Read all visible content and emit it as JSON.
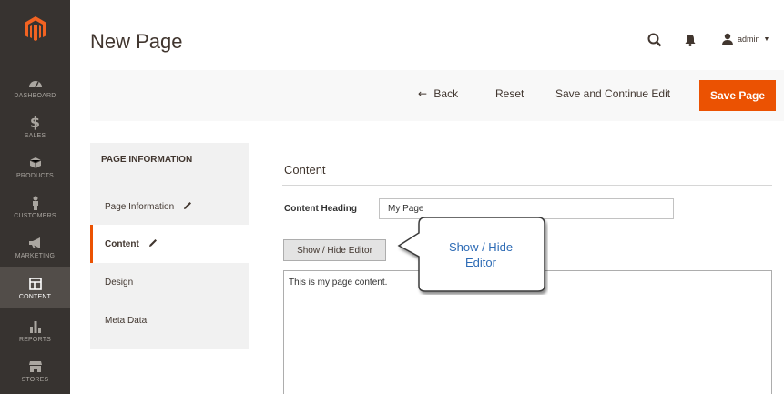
{
  "nav": {
    "items": [
      {
        "label": "Dashboard",
        "icon": "dashboard-icon"
      },
      {
        "label": "Sales",
        "icon": "dollar-icon"
      },
      {
        "label": "Products",
        "icon": "box-icon"
      },
      {
        "label": "Customers",
        "icon": "person-icon"
      },
      {
        "label": "Marketing",
        "icon": "megaphone-icon"
      },
      {
        "label": "Content",
        "icon": "layout-icon"
      },
      {
        "label": "Reports",
        "icon": "bar-chart-icon"
      },
      {
        "label": "Stores",
        "icon": "storefront-icon"
      }
    ],
    "active": "Content",
    "logo": "magento-logo"
  },
  "header": {
    "title": "New Page",
    "user": "admin"
  },
  "toolbar": {
    "back_label": "Back",
    "reset_label": "Reset",
    "save_continue_label": "Save and Continue Edit",
    "save_label": "Save Page"
  },
  "tabs": {
    "title": "PAGE INFORMATION",
    "items": [
      {
        "label": "Page Information"
      },
      {
        "label": "Content"
      },
      {
        "label": "Design"
      },
      {
        "label": "Meta Data"
      }
    ]
  },
  "content": {
    "section_title": "Content",
    "heading_label": "Content Heading",
    "heading_value": "My Page",
    "editor_button": "Show / Hide Editor",
    "editor_text": "This is my page content."
  },
  "callout": {
    "line1": "Show / Hide",
    "line2": "Editor"
  },
  "colors": {
    "accent": "#eb5202",
    "nav_bg": "#373330",
    "callout_text": "#2d6bb5"
  }
}
